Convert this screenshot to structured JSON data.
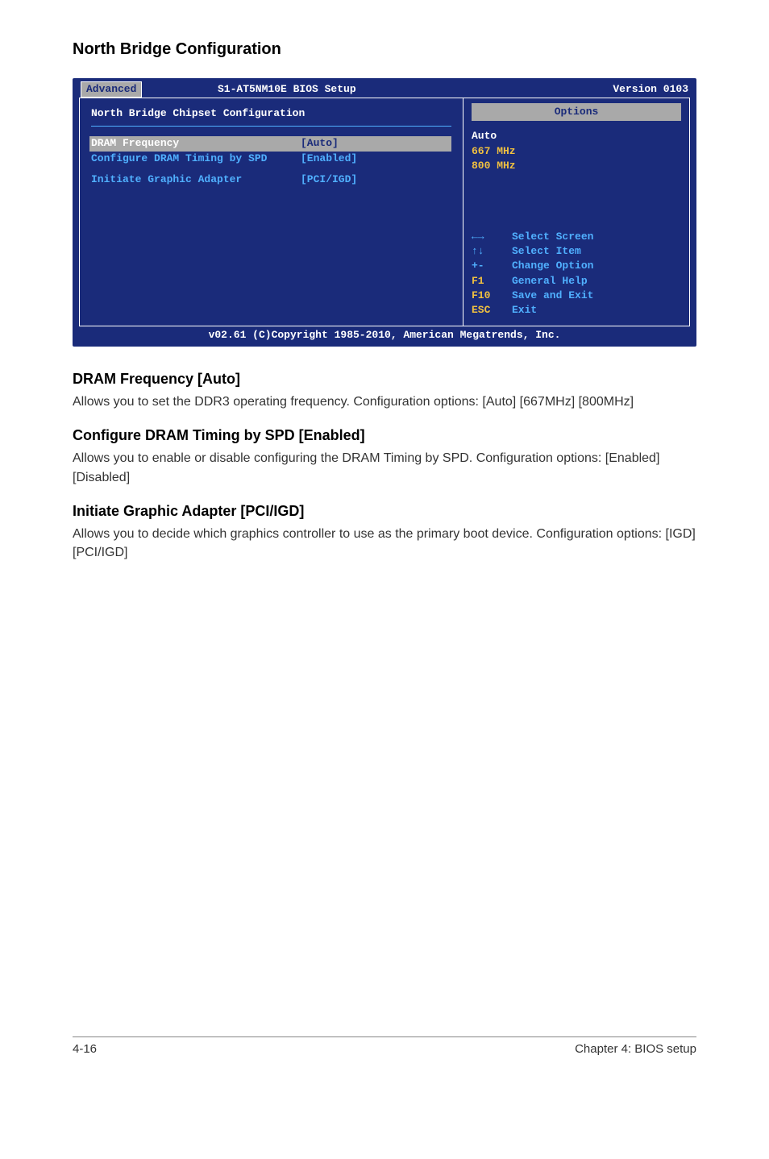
{
  "page_title": "North Bridge Configuration",
  "bios": {
    "setup_title": "S1-AT5NM10E BIOS Setup",
    "version": "Version 0103",
    "tab": "Advanced",
    "panel_title": "North Bridge Chipset Configuration",
    "rows": {
      "r0_label": "DRAM Frequency",
      "r0_val": "[Auto]",
      "r1_label": "Configure DRAM Timing by SPD",
      "r1_val": "[Enabled]",
      "r2_label": "Initiate Graphic Adapter",
      "r2_val": "[PCI/IGD]"
    },
    "options_title": "Options",
    "options": {
      "o0": "Auto",
      "o1": "667 MHz",
      "o2": "800 MHz"
    },
    "help": {
      "k0": "←→",
      "v0": "Select Screen",
      "k1": "↑↓",
      "v1": "Select Item",
      "k2": "+-",
      "v2": "Change Option",
      "k3": "F1",
      "v3": "General Help",
      "k4": "F10",
      "v4": "Save and Exit",
      "k5": "ESC",
      "v5": "Exit"
    },
    "footer": "v02.61 (C)Copyright 1985-2010, American Megatrends, Inc."
  },
  "sections": {
    "s0_title": "DRAM Frequency [Auto]",
    "s0_body": "Allows you to set the DDR3 operating frequency. Configuration options: [Auto] [667MHz] [800MHz]",
    "s1_title": "Configure DRAM Timing by SPD [Enabled]",
    "s1_body": "Allows you to enable or disable configuring the DRAM Timing by SPD. Configuration options: [Enabled] [Disabled]",
    "s2_title": "Initiate Graphic Adapter [PCI/IGD]",
    "s2_body": "Allows you to decide which graphics controller to use as the primary boot device. Configuration options: [IGD] [PCI/IGD]"
  },
  "footer": {
    "left": "4-16",
    "right": "Chapter 4: BIOS setup"
  },
  "chart_data": {
    "type": "table",
    "title": "North Bridge Chipset Configuration",
    "settings": [
      {
        "name": "DRAM Frequency",
        "value": "[Auto]",
        "options": [
          "Auto",
          "667 MHz",
          "800 MHz"
        ]
      },
      {
        "name": "Configure DRAM Timing by SPD",
        "value": "[Enabled]",
        "options": [
          "Enabled",
          "Disabled"
        ]
      },
      {
        "name": "Initiate Graphic Adapter",
        "value": "[PCI/IGD]",
        "options": [
          "IGD",
          "PCI/IGD"
        ]
      }
    ]
  }
}
